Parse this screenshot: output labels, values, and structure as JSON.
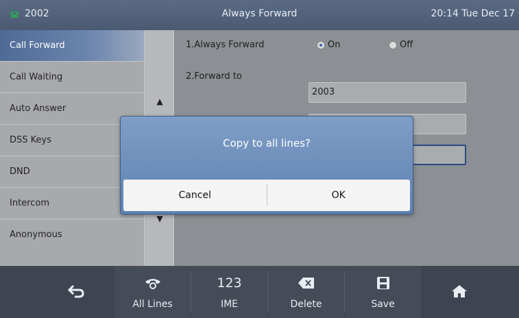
{
  "header": {
    "line": "2002",
    "title": "Always Forward",
    "datetime": "20:14 Tue Dec 17"
  },
  "sidebar": {
    "items": [
      {
        "label": "Call Forward",
        "active": true
      },
      {
        "label": "Call Waiting"
      },
      {
        "label": "Auto Answer"
      },
      {
        "label": "DSS Keys"
      },
      {
        "label": "DND"
      },
      {
        "label": "Intercom"
      },
      {
        "label": "Anonymous"
      }
    ]
  },
  "scroll": {
    "up_icon": "up-arrow-icon",
    "down_icon": "down-arrow-icon"
  },
  "form": {
    "always_forward_label": "1.Always Forward",
    "on_label": "On",
    "off_label": "Off",
    "selected": "On",
    "forward_to_label": "2.Forward to",
    "forward_to_value": "2003"
  },
  "dialog": {
    "message": "Copy to all lines?",
    "cancel_label": "Cancel",
    "ok_label": "OK"
  },
  "softkeys": {
    "back": {
      "icon": "back-arrow-icon"
    },
    "all_lines": {
      "icon": "phone-icon",
      "label": "All Lines"
    },
    "ime": {
      "glyph": "123",
      "label": "IME"
    },
    "delete": {
      "icon": "backspace-icon",
      "label": "Delete"
    },
    "save": {
      "icon": "floppy-disk-icon",
      "label": "Save"
    },
    "home": {
      "icon": "home-icon"
    }
  },
  "colors": {
    "header_bg": "#4f5f77",
    "active_item": "#5a73a0",
    "dialog_bg": "#6f90bd",
    "softkey_bg": "#454c57"
  }
}
